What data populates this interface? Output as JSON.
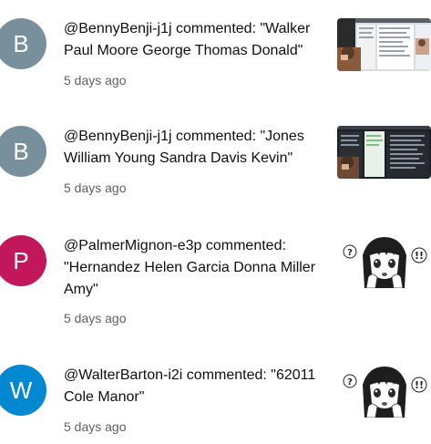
{
  "notifications": [
    {
      "avatar_letter": "B",
      "avatar_color": "#78909c",
      "text": "@BennyBenji-j1j commented: \"Walker Paul Moore George Thomas Donald\"",
      "time": "5 days ago",
      "thumbnail": "screen-recording-thumbnail"
    },
    {
      "avatar_letter": "B",
      "avatar_color": "#78909c",
      "text": "@BennyBenji-j1j commented: \"Jones William Young Sandra Davis Kevin\"",
      "time": "5 days ago",
      "thumbnail": "dark-screen-recording-thumbnail"
    },
    {
      "avatar_letter": "P",
      "avatar_color": "#c2185b",
      "text": "@PalmerMignon-e3p commented: \"Hernandez Helen Garcia Donna Miller Amy\"",
      "time": "5 days ago",
      "thumbnail": "manga-girl-thumbnail"
    },
    {
      "avatar_letter": "W",
      "avatar_color": "#0288d1",
      "text": "@WalterBarton-i2i commented: \"62011 Cole Manor\"",
      "time": "5 days ago",
      "thumbnail": "manga-girl-thumbnail"
    }
  ]
}
